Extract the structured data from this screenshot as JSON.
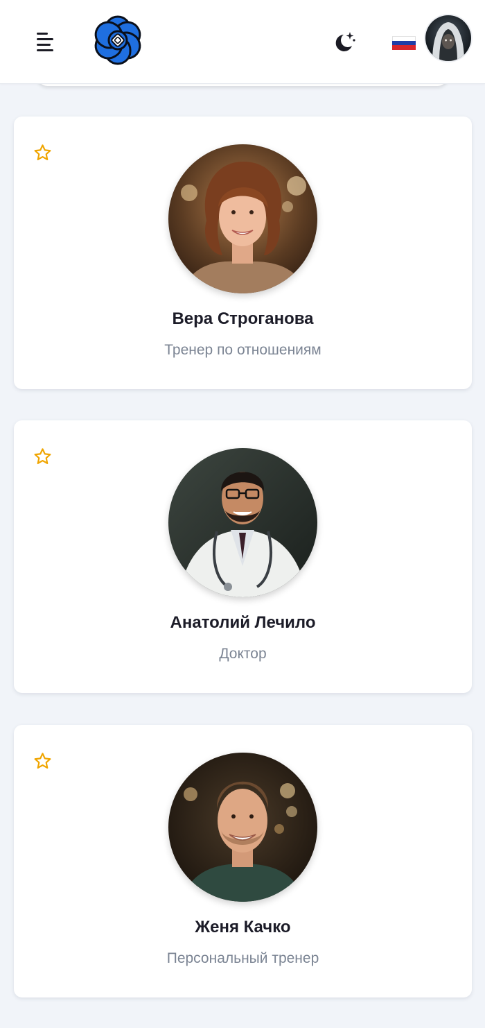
{
  "header": {
    "menu_icon": "hamburger-menu-icon",
    "logo_icon": "openai-knot-logo",
    "theme_icon": "moon-stars-icon",
    "language_flag": "russia-flag",
    "avatar_icon": "hooded-user-avatar"
  },
  "colors": {
    "star": "#f0a500",
    "logo_blue": "#1f6fe0",
    "flag_white": "#ffffff",
    "flag_blue": "#1f3ea8",
    "flag_red": "#d8262c"
  },
  "cards": [
    {
      "name": "Вера Строганова",
      "role": "Тренер по отношениям",
      "favorite_icon": "star-outline-icon"
    },
    {
      "name": "Анатолий Лечило",
      "role": "Доктор",
      "favorite_icon": "star-outline-icon"
    },
    {
      "name": "Женя Качко",
      "role": "Персональный тренер",
      "favorite_icon": "star-outline-icon"
    }
  ]
}
